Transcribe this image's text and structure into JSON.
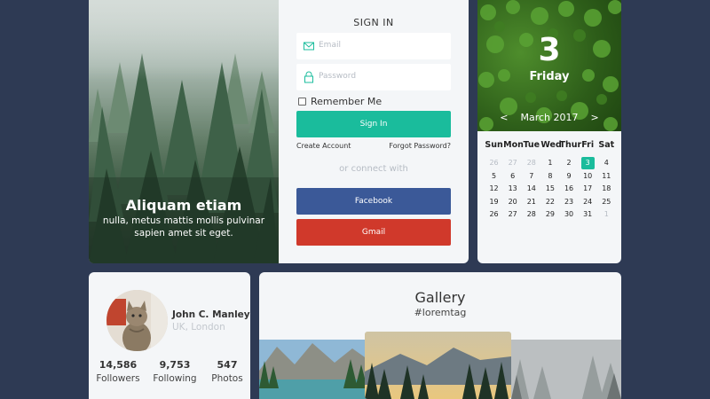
{
  "login": {
    "hero_title": "Aliquam etiam",
    "hero_subtitle": "nulla, metus mattis mollis pulvinar sapien amet sit eget.",
    "title": "SIGN IN",
    "email_placeholder": "Email",
    "password_placeholder": "Password",
    "remember_label": "Remember Me",
    "signin_label": "Sign In",
    "create_account": "Create Account",
    "forgot_password": "Forgot Password?",
    "connect_with": "or connect with",
    "facebook_label": "Facebook",
    "gmail_label": "Gmail"
  },
  "calendar": {
    "day_number": "3",
    "weekday": "Friday",
    "prev": "<",
    "month_label": "March 2017",
    "next": ">",
    "headers": [
      "Sun",
      "Mon",
      "Tue",
      "Wed",
      "Thur",
      "Fri",
      "Sat"
    ],
    "weeks": [
      [
        "26",
        "27",
        "28",
        "1",
        "2",
        "3",
        "4"
      ],
      [
        "5",
        "6",
        "7",
        "8",
        "9",
        "10",
        "11"
      ],
      [
        "12",
        "13",
        "14",
        "15",
        "16",
        "17",
        "18"
      ],
      [
        "19",
        "20",
        "21",
        "22",
        "23",
        "24",
        "25"
      ],
      [
        "26",
        "27",
        "28",
        "29",
        "30",
        "31",
        "1"
      ]
    ],
    "selected_day": "3"
  },
  "profile": {
    "name": "John C. Manley",
    "location": "UK, London",
    "stats": [
      {
        "value": "14,586",
        "label": "Followers"
      },
      {
        "value": "9,753",
        "label": "Following"
      },
      {
        "value": "547",
        "label": "Photos"
      }
    ]
  },
  "gallery": {
    "title": "Gallery",
    "tag": "#loremtag"
  },
  "colors": {
    "background": "#2e3a54",
    "accent": "#1abc9c",
    "facebook": "#3b5998",
    "gmail": "#d0392b"
  }
}
